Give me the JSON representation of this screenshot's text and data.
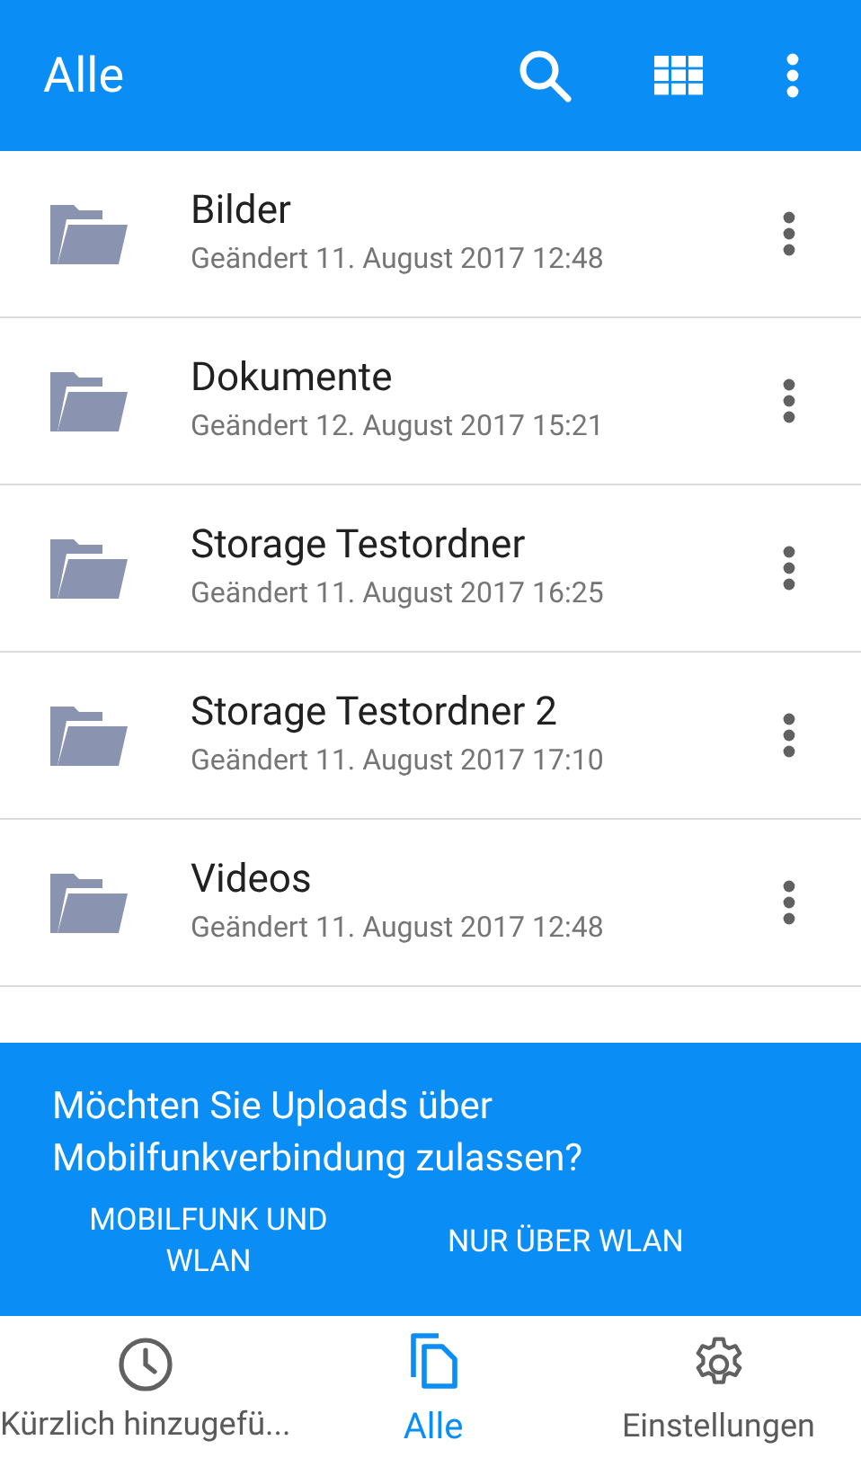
{
  "app_bar": {
    "title": "Alle"
  },
  "folders": [
    {
      "name": "Bilder",
      "modified": "Geändert 11. August 2017 12:48"
    },
    {
      "name": "Dokumente",
      "modified": "Geändert 12. August 2017 15:21"
    },
    {
      "name": "Storage Testordner",
      "modified": "Geändert 11. August 2017 16:25"
    },
    {
      "name": "Storage Testordner 2",
      "modified": "Geändert 11. August 2017 17:10"
    },
    {
      "name": "Videos",
      "modified": "Geändert 11. August 2017 12:48"
    }
  ],
  "upload_prompt": {
    "question": "Möchten Sie Uploads über Mobilfunkverbindung zulassen?",
    "buttons": [
      "MOBILFUNK UND WLAN",
      "NUR ÜBER WLAN"
    ]
  },
  "bottom_nav": [
    {
      "kind": "recent",
      "label": "Kürzlich hinzugefü...",
      "selected": false
    },
    {
      "kind": "all",
      "label": "Alle",
      "selected": true
    },
    {
      "kind": "settings",
      "label": "Einstellungen",
      "selected": false
    }
  ]
}
